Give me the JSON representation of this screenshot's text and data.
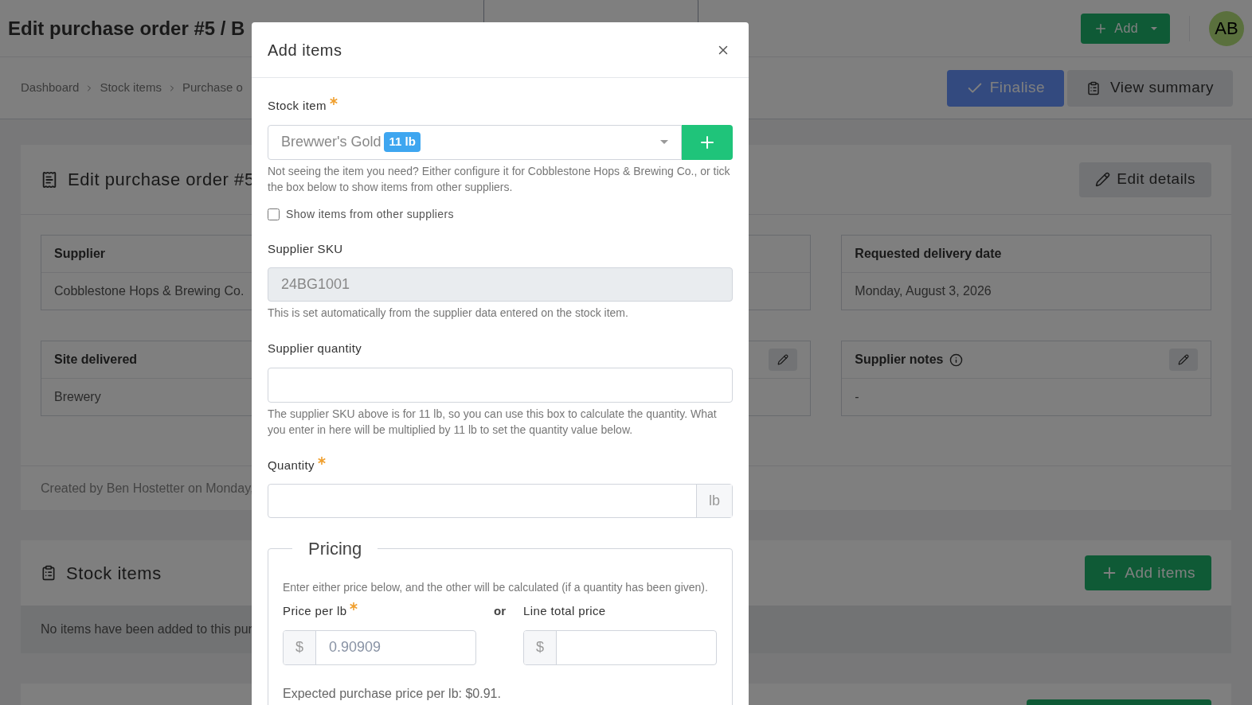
{
  "header": {
    "title": "Edit purchase order #5 / B",
    "add_button": "Add",
    "avatar": "AB"
  },
  "breadcrumbs": [
    "Dashboard",
    "Stock items",
    "Purchase o"
  ],
  "actions": {
    "finalise": "Finalise",
    "view_summary": "View summary"
  },
  "order_card": {
    "title": "Edit purchase order #5",
    "edit_button": "Edit details",
    "fields": [
      {
        "kind": "detail",
        "label": "Supplier",
        "value": "Cobblestone Hops & Brewing Co.",
        "info": false
      },
      {
        "kind": "detail"
      },
      {
        "kind": "detail",
        "label": "Requested delivery date",
        "value": "Monday, August 3, 2026",
        "editable": false,
        "info": false
      },
      {
        "kind": "detail",
        "label": "Site delivered",
        "value": "Brewery",
        "info": false
      },
      {
        "kind": "detail",
        "editable": true
      },
      {
        "kind": "detail",
        "label": "Supplier notes",
        "value": "-",
        "editable": true,
        "info": true
      }
    ],
    "footer": "Created by Ben Hostetter on Monday,"
  },
  "stock_card": {
    "title": "Stock items",
    "add_button": "Add items",
    "empty_text": "No items have been added to this pur"
  },
  "modal": {
    "title": "Add items",
    "stock_item": {
      "label": "Stock item",
      "required": true,
      "value": "Brewwer's Gold",
      "badge": "11 lb",
      "help": "Not seeing the item you need? Either configure it for Cobblestone Hops & Brewing Co., or tick the box below to show items from other suppliers."
    },
    "other_suppliers": {
      "label": "Show items from other suppliers",
      "checked": false
    },
    "supplier_sku": {
      "label": "Supplier SKU",
      "required": false,
      "value": "24BG1001",
      "disabled": true,
      "help": "This is set automatically from the supplier data entered on the stock item."
    },
    "supplier_quantity": {
      "label": "Supplier quantity",
      "required": false,
      "help": "The supplier SKU above is for 11 lb, so you can use this box to calculate the quantity. What you enter in here will be multiplied by 11 lb to set the quantity value below."
    },
    "quantity": {
      "label": "Quantity",
      "required": true,
      "unit": "lb"
    },
    "pricing": {
      "legend": "Pricing",
      "intro": "Enter either price below, and the other will be calculated (if a quantity has been given).",
      "price_per": {
        "label": "Price per lb",
        "required": true,
        "prefix": "$",
        "value": "0.90909"
      },
      "or": "or",
      "line_total": {
        "label": "Line total price",
        "required": false,
        "prefix": "$"
      },
      "expected": "Expected purchase price per lb: $0.91."
    }
  }
}
